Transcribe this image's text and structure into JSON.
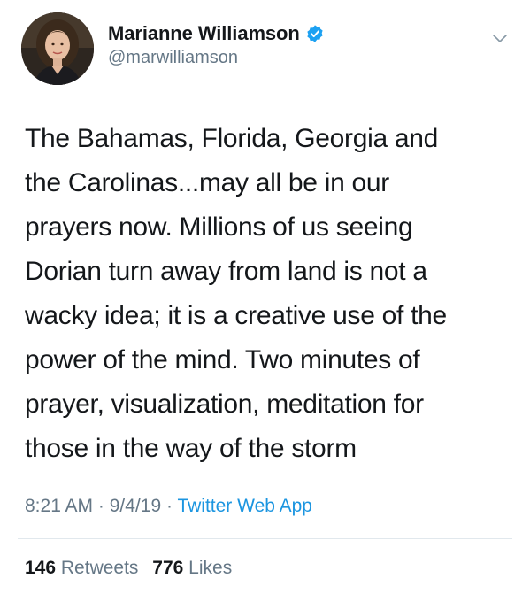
{
  "author": {
    "display_name": "Marianne Williamson",
    "handle": "@marwilliamson",
    "avatar": "profile-photo",
    "verified_icon": "verified-badge-icon",
    "verified_color": "#1da1f2"
  },
  "header": {
    "menu_icon": "chevron-down-icon"
  },
  "tweet": {
    "text": "The Bahamas, Florida, Georgia and\nthe Carolinas...may all be in our\nprayers now. Millions of us seeing\nDorian turn away from land is not a\nwacky idea; it is a creative use of the\npower of the mind. Two minutes of\nprayer, visualization, meditation for\nthose in the way of the storm",
    "time": "8:21 AM",
    "separator": "·",
    "date": "9/4/19",
    "source": "Twitter Web App"
  },
  "stats": {
    "retweets_count": "146",
    "retweets_label": "Retweets",
    "likes_count": "776",
    "likes_label": "Likes"
  },
  "colors": {
    "text": "#14171a",
    "secondary": "#657786",
    "link": "#1b95e0",
    "divider": "#e1e8ed"
  }
}
